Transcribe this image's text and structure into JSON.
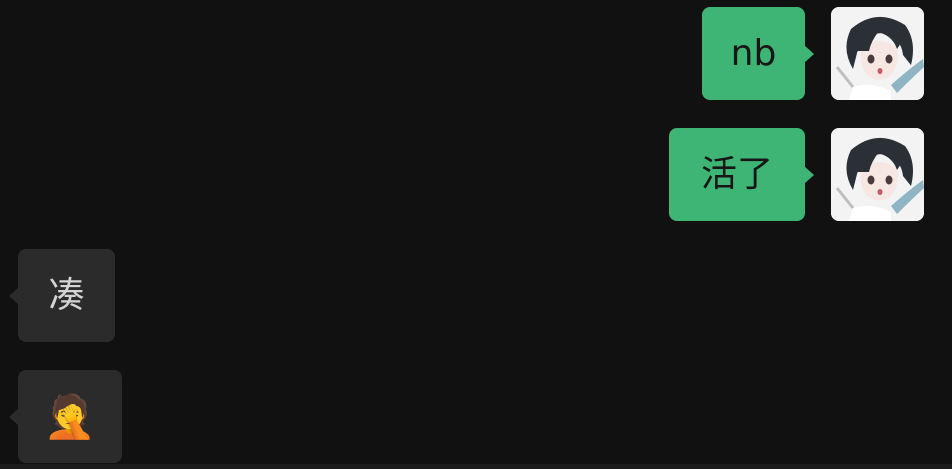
{
  "messages": [
    {
      "side": "sent",
      "text": "nb"
    },
    {
      "side": "sent",
      "text": "活了"
    },
    {
      "side": "received",
      "text": "凑"
    },
    {
      "side": "received",
      "icon": "facepalm-laughing-emoji",
      "glyph": "🤦"
    }
  ],
  "colors": {
    "background": "#111111",
    "sent_bubble": "#3eb575",
    "received_bubble": "#2b2b2b"
  }
}
